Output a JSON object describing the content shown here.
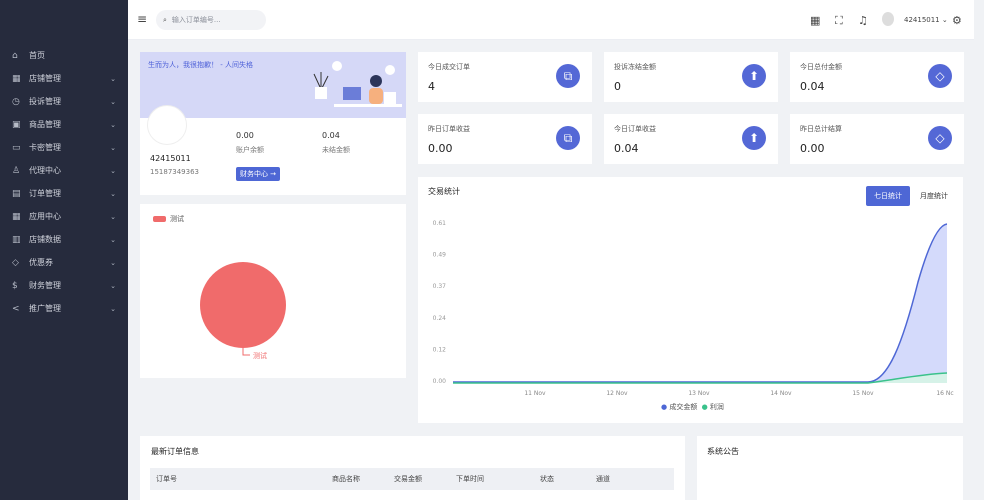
{
  "sidebar": {
    "items": [
      {
        "label": "首页",
        "icon": "home-icon",
        "glyph": "⌂",
        "arrow": false
      },
      {
        "label": "店铺管理",
        "icon": "store-icon",
        "glyph": "▦",
        "arrow": true
      },
      {
        "label": "投诉管理",
        "icon": "complaint-icon",
        "glyph": "◷",
        "arrow": true
      },
      {
        "label": "商品管理",
        "icon": "product-icon",
        "glyph": "▣",
        "arrow": true
      },
      {
        "label": "卡密管理",
        "icon": "card-icon",
        "glyph": "▭",
        "arrow": true
      },
      {
        "label": "代理中心",
        "icon": "agent-icon",
        "glyph": "♙",
        "arrow": true
      },
      {
        "label": "订单管理",
        "icon": "order-icon",
        "glyph": "▤",
        "arrow": true
      },
      {
        "label": "应用中心",
        "icon": "apps-icon",
        "glyph": "▦",
        "arrow": true
      },
      {
        "label": "店铺数据",
        "icon": "data-icon",
        "glyph": "▥",
        "arrow": true
      },
      {
        "label": "优惠券",
        "icon": "coupon-icon",
        "glyph": "◇",
        "arrow": true
      },
      {
        "label": "财务管理",
        "icon": "finance-icon",
        "glyph": "$",
        "arrow": true
      },
      {
        "label": "推广管理",
        "icon": "share-icon",
        "glyph": "<",
        "arrow": true
      }
    ]
  },
  "topbar": {
    "menu": "≡",
    "search_placeholder": "输入订单编号...",
    "username": "42415011",
    "icons": {
      "qr": "▦",
      "fullscreen": "⛶",
      "bell": "♫",
      "settings": "⚙"
    }
  },
  "profile": {
    "motto": "生而为人，我很抱歉！ - 人间失格",
    "name": "42415011",
    "phone": "15187349363",
    "balance": "0.00",
    "balance_label": "账户余额",
    "unsettled": "0.04",
    "unsettled_label": "未结金额",
    "finance_button": "财务中心 →"
  },
  "pie": {
    "legend": "测试",
    "label": "测试",
    "color": "#f06b6b"
  },
  "stats": [
    {
      "title": "今日成交订单",
      "value": "4",
      "icon": "copy-icon",
      "glyph": "⧉"
    },
    {
      "title": "投诉冻结金额",
      "value": "0",
      "icon": "upload-icon",
      "glyph": "⬆"
    },
    {
      "title": "今日总付金额",
      "value": "0.04",
      "icon": "tag-icon",
      "glyph": "◇"
    },
    {
      "title": "昨日订单收益",
      "value": "0.00",
      "icon": "copy-icon",
      "glyph": "⧉"
    },
    {
      "title": "今日订单收益",
      "value": "0.04",
      "icon": "upload-icon",
      "glyph": "⬆"
    },
    {
      "title": "昨日总计结算",
      "value": "0.00",
      "icon": "tag-icon",
      "glyph": "◇"
    }
  ],
  "trade": {
    "title": "交易统计",
    "tab_week": "七日统计",
    "tab_month": "月度统计",
    "legend": [
      "成交金额",
      "利润"
    ],
    "y_labels": [
      "0.61",
      "0.49",
      "0.37",
      "0.24",
      "0.12",
      "0.00"
    ],
    "x_labels": [
      "11 Nov",
      "12 Nov",
      "13 Nov",
      "14 Nov",
      "15 Nov",
      "16 Nc"
    ],
    "series": [
      0,
      0,
      0,
      0,
      0,
      0.61
    ],
    "profit": [
      0,
      0,
      0,
      0,
      0,
      0.04
    ]
  },
  "orders": {
    "title": "最新订单信息",
    "columns": [
      "订单号",
      "商品名称",
      "交易金额",
      "下单时间",
      "状态",
      "通道"
    ]
  },
  "notice": {
    "title": "系统公告"
  }
}
